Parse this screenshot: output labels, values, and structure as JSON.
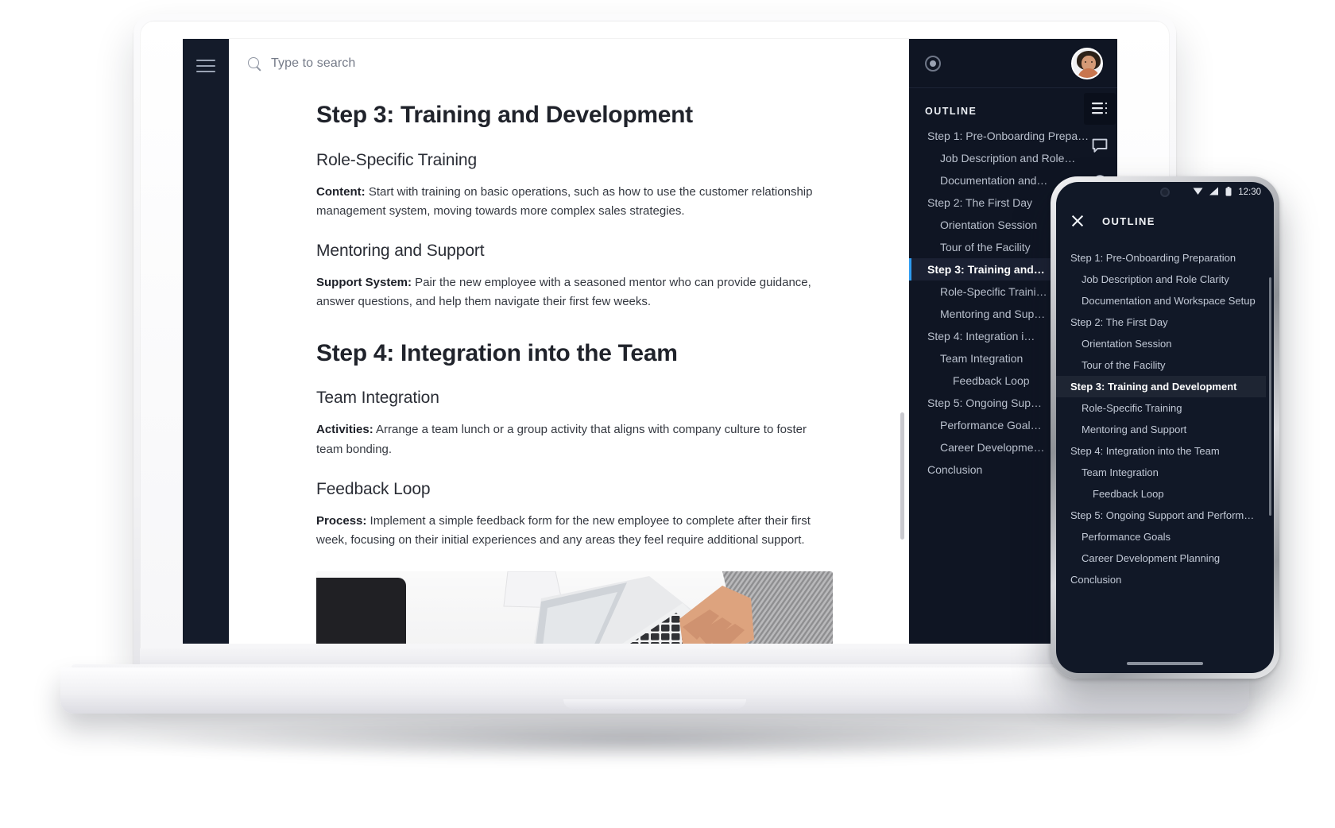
{
  "app": {
    "search": {
      "placeholder": "Type to search",
      "icon": "search-icon"
    },
    "menu_icon": "hamburger-icon"
  },
  "document": {
    "heading_1": "Step 3: Training and Development",
    "sub_1": "Role-Specific Training",
    "para_1_label": "Content:",
    "para_1_text": " Start with training on basic operations, such as how to use the customer relationship management system, moving towards more complex sales strategies.",
    "sub_2": "Mentoring and Support",
    "para_2_label": "Support System:",
    "para_2_text": " Pair the new employee with a seasoned mentor who can provide guidance, answer questions, and help them navigate their first few weeks.",
    "heading_2": "Step 4: Integration into the Team",
    "sub_3": "Team Integration",
    "para_3_label": "Activities:",
    "para_3_text": " Arrange a team lunch or a group activity that aligns with company culture to foster team bonding.",
    "sub_4": "Feedback Loop",
    "para_4_label": "Process:",
    "para_4_text": " Implement a simple feedback form for the new employee to complete after their first week, focusing on their initial experiences and any areas they feel require additional support.",
    "image_alt": "Top-down photo of a desk with a person typing on a laptop, a desk phone and a printer"
  },
  "outline_panel": {
    "title": "OUTLINE",
    "status_icon": "record-circle-icon",
    "avatar": "user-avatar",
    "rail_icons": [
      {
        "name": "outline-list-icon",
        "selected": true
      },
      {
        "name": "comment-icon",
        "selected": false
      },
      {
        "name": "history-icon",
        "selected": false
      }
    ],
    "items": [
      {
        "label": "Step 1: Pre-Onboarding Prepa…",
        "level": 1,
        "active": false
      },
      {
        "label": "Job Description and Role…",
        "level": 2,
        "active": false
      },
      {
        "label": "Documentation and…",
        "level": 2,
        "active": false
      },
      {
        "label": "Step 2: The First Day",
        "level": 1,
        "active": false
      },
      {
        "label": "Orientation Session",
        "level": 2,
        "active": false
      },
      {
        "label": "Tour of the Facility",
        "level": 2,
        "active": false
      },
      {
        "label": "Step 3: Training and…",
        "level": 1,
        "active": true
      },
      {
        "label": "Role-Specific Traini…",
        "level": 2,
        "active": false
      },
      {
        "label": "Mentoring and Sup…",
        "level": 2,
        "active": false
      },
      {
        "label": "Step 4: Integration i…",
        "level": 1,
        "active": false
      },
      {
        "label": "Team Integration",
        "level": 2,
        "active": false
      },
      {
        "label": "Feedback Loop",
        "level": 3,
        "active": false
      },
      {
        "label": "Step 5: Ongoing Sup…",
        "level": 1,
        "active": false
      },
      {
        "label": "Performance Goal…",
        "level": 2,
        "active": false
      },
      {
        "label": "Career Developme…",
        "level": 2,
        "active": false
      },
      {
        "label": "Conclusion",
        "level": 1,
        "active": false
      }
    ]
  },
  "phone": {
    "status_time": "12:30",
    "status_icons": [
      "wifi-icon",
      "signal-icon",
      "battery-icon"
    ],
    "close_label": "close-icon",
    "title": "OUTLINE",
    "items": [
      {
        "label": "Step 1: Pre-Onboarding Preparation",
        "level": 1,
        "active": false
      },
      {
        "label": "Job Description and Role Clarity",
        "level": 2,
        "active": false
      },
      {
        "label": "Documentation and Workspace Setup",
        "level": 2,
        "active": false
      },
      {
        "label": "Step 2: The First Day",
        "level": 1,
        "active": false
      },
      {
        "label": "Orientation Session",
        "level": 2,
        "active": false
      },
      {
        "label": "Tour of the Facility",
        "level": 2,
        "active": false
      },
      {
        "label": "Step 3: Training and Development",
        "level": 1,
        "active": true
      },
      {
        "label": "Role-Specific Training",
        "level": 2,
        "active": false
      },
      {
        "label": "Mentoring and Support",
        "level": 2,
        "active": false
      },
      {
        "label": "Step 4: Integration into the Team",
        "level": 1,
        "active": false
      },
      {
        "label": "Team Integration",
        "level": 2,
        "active": false
      },
      {
        "label": "Feedback Loop",
        "level": 3,
        "active": false
      },
      {
        "label": "Step 5: Ongoing Support and Performan…",
        "level": 1,
        "active": false
      },
      {
        "label": "Performance Goals",
        "level": 2,
        "active": false
      },
      {
        "label": "Career Development Planning",
        "level": 2,
        "active": false
      },
      {
        "label": "Conclusion",
        "level": 1,
        "active": false
      }
    ]
  },
  "colors": {
    "panel_dark": "#0f1523",
    "rail_dark": "#141b2a",
    "accent_blue": "#2e9bf0",
    "active_row": "#1b2133"
  }
}
